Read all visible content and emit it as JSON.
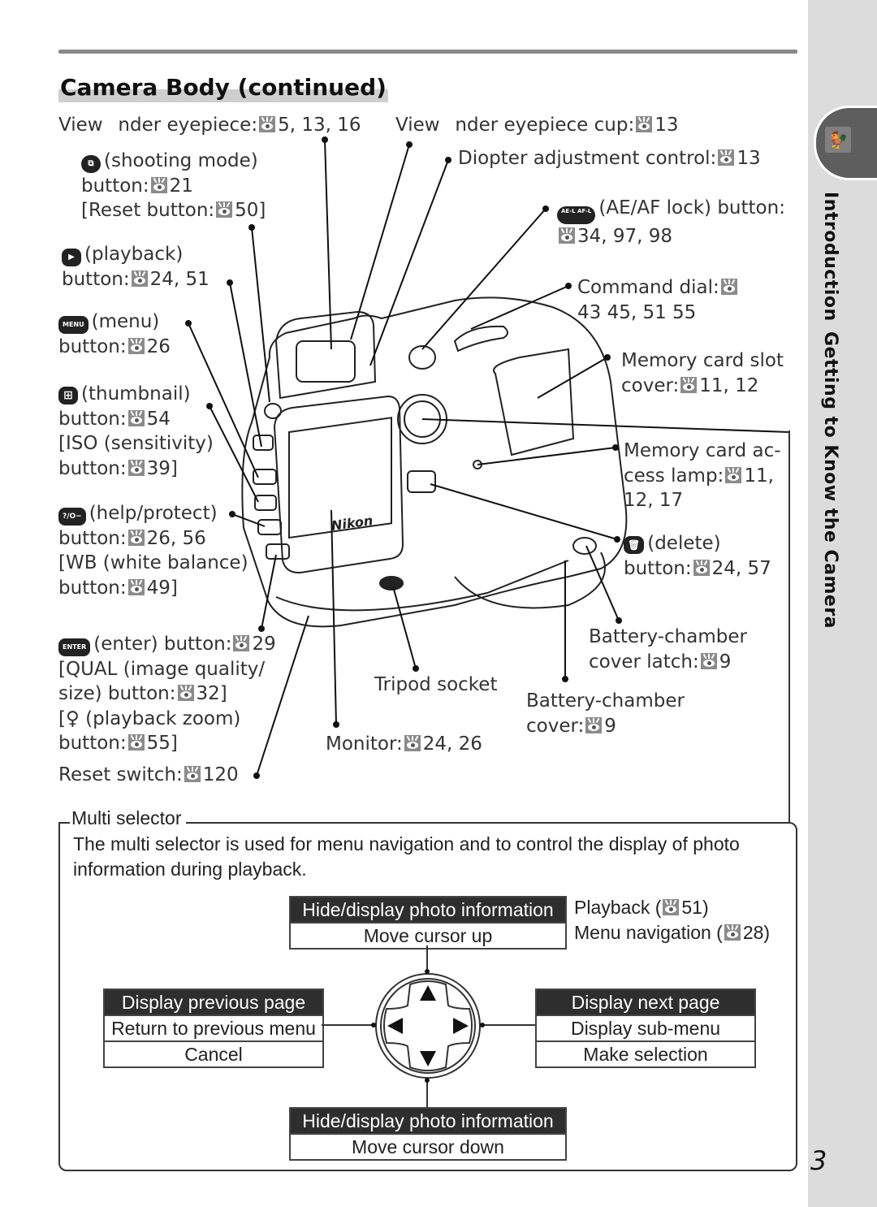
{
  "header": {
    "title": "Camera Body (continued)"
  },
  "side_tab": {
    "section_1": "Introduction",
    "section_2": "Getting to Know the Camera",
    "icon": "weathervane-icon"
  },
  "page_number": "3",
  "labels": {
    "viewfinder_eyepiece": {
      "text": "View  nder eyepiece:",
      "pages": "5, 13, 16"
    },
    "viewfinder_cup": {
      "text": "View  nder eyepiece cup:",
      "pages": "13"
    },
    "diopter": {
      "text": "Diopter adjustment control:",
      "pages": "13"
    },
    "shooting_mode": {
      "icon_text": "⧉",
      "line1": "(shooting mode)",
      "line2": "button:",
      "pages": "21",
      "line3": "[Reset button:",
      "pages2": "50]"
    },
    "ae_af_lock": {
      "icon_text": "AE-L AF-L",
      "line1": "(AE/AF lock) button:",
      "pages": "34, 97, 98"
    },
    "playback": {
      "icon_text": "▶",
      "line1": "(playback)",
      "line2": "button:",
      "pages": "24, 51"
    },
    "command_dial": {
      "line1": "Command dial:",
      "pages": "43  45, 51  55"
    },
    "menu": {
      "icon_text": "MENU",
      "line1": "(menu)",
      "line2": "button:",
      "pages": "26"
    },
    "memory_card_slot": {
      "line1": "Memory card slot",
      "line2": "cover:",
      "pages": "11, 12"
    },
    "thumbnail": {
      "icon_text": "⊞",
      "line1": "(thumbnail)",
      "line2": "button:",
      "pages": "54",
      "line3": "[ISO (sensitivity)",
      "line4": "button:",
      "pages2": "39]"
    },
    "access_lamp": {
      "line1": "Memory card ac-",
      "line2": "cess lamp:",
      "pages": "11,",
      "line3": "12, 17"
    },
    "help_protect": {
      "icon_text": "?/O−",
      "line1": "(help/protect)",
      "line2": "button:",
      "pages": "26, 56",
      "line3": "[WB (white balance)",
      "line4": "button:",
      "pages2": "49]"
    },
    "delete": {
      "icon_text": "🗑",
      "line1": "(delete)",
      "line2": "button:",
      "pages": "24, 57"
    },
    "enter": {
      "icon_text": "ENTER",
      "line1": "(enter) button:",
      "pages": "29",
      "line2": "[QUAL (image quality/",
      "line3": "size) button:",
      "pages2": "32]",
      "line4": "[♀ (playback zoom)",
      "line5": "button:",
      "pages3": "55]"
    },
    "battery_latch": {
      "line1": "Battery-chamber",
      "line2": "cover latch:",
      "pages": "9"
    },
    "tripod": {
      "line1": "Tripod socket"
    },
    "battery_cover": {
      "line1": "Battery-chamber",
      "line2": "cover:",
      "pages": "9"
    },
    "monitor": {
      "line1": "Monitor:",
      "pages": "24, 26"
    },
    "reset_switch": {
      "line1": "Reset switch:",
      "pages": "120"
    }
  },
  "multi_selector": {
    "legend": "Multi selector",
    "description": "The multi selector is used for menu navigation and to control the display of photo information during playback.",
    "modes": {
      "playback": {
        "label": "Playback (",
        "pages": "51)"
      },
      "menu": {
        "label": "Menu navigation (",
        "pages": "28)"
      }
    },
    "up": [
      "Hide/display photo information",
      "Move cursor up"
    ],
    "left": [
      "Display previous page",
      "Return to previous menu",
      "Cancel"
    ],
    "right": [
      "Display next page",
      "Display sub-menu",
      "Make selection"
    ],
    "down": [
      "Hide/display photo information",
      "Move cursor down"
    ]
  },
  "colors": {
    "accent_gray": "#dcdcdc",
    "tab_dark": "#5e5e5e",
    "table_header": "#2e2e2e"
  }
}
